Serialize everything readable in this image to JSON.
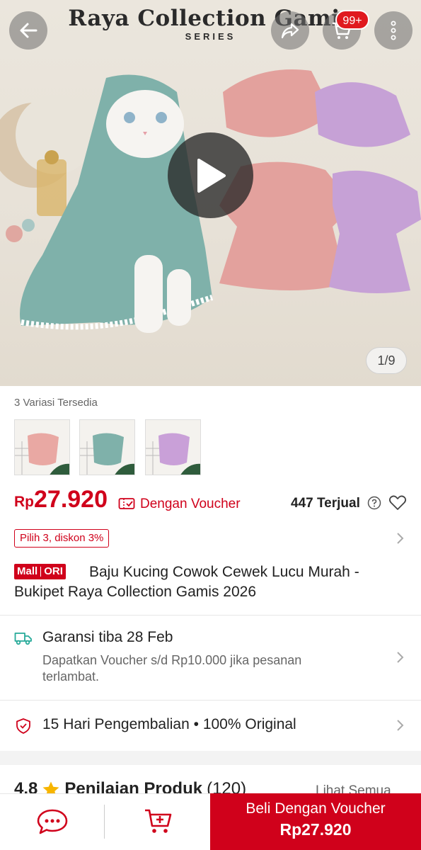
{
  "hero": {
    "banner_title": "Raya Collection Gamis",
    "banner_subtitle": "SERIES",
    "cart_count": "99+",
    "image_counter": "1/9"
  },
  "variants": {
    "label": "3 Variasi Tersedia",
    "items": [
      {
        "color": "#e9a8a3"
      },
      {
        "color": "#7fb1aa"
      },
      {
        "color": "#c9a0d8"
      }
    ]
  },
  "price": {
    "currency": "Rp",
    "value": "27.920",
    "voucher_label": "Dengan Voucher",
    "sold": "447 Terjual"
  },
  "promo": {
    "tag": "Pilih 3, diskon 3%"
  },
  "product": {
    "badge_mall": "Mall",
    "badge_ori": "ORI",
    "title": "Baju Kucing Cowok Cewek Lucu Murah - Bukipet Raya Collection Gamis 2026"
  },
  "shipping": {
    "title": "Garansi tiba 28 Feb",
    "desc": "Dapatkan Voucher s/d Rp10.000 jika pesanan terlambat."
  },
  "returns": {
    "text": "15 Hari Pengembalian  •  100% Original"
  },
  "rating": {
    "score": "4.8",
    "label": "Penilaian Produk",
    "count": "(120)",
    "see_all": "Lihat Semua"
  },
  "bottom_bar": {
    "buy_label": "Beli Dengan Voucher",
    "buy_price": "Rp27.920"
  },
  "colors": {
    "brand_red": "#d0011b",
    "hero_bg": "#e9e4da",
    "teal_dress": "#7fb1aa",
    "pink_dress": "#e9a8a3",
    "lilac_dress": "#c9a0d8"
  }
}
